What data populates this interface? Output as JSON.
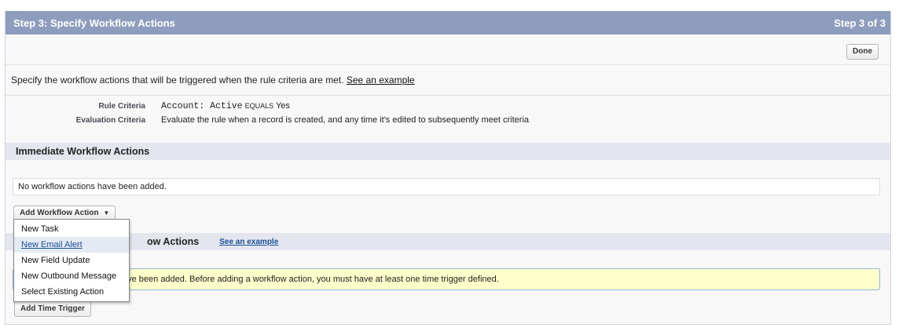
{
  "header": {
    "title": "Step 3: Specify Workflow Actions",
    "step": "Step 3 of 3"
  },
  "toolbar": {
    "done_label": "Done"
  },
  "intro": {
    "text": "Specify the workflow actions that will be triggered when the rule criteria are met.",
    "link": "See an example"
  },
  "criteria": {
    "rule_label": "Rule Criteria",
    "rule_field": "Account: Active",
    "rule_operator": "EQUALS",
    "rule_value": "Yes",
    "evaluation_label": "Evaluation Criteria",
    "evaluation_value": "Evaluate the rule when a record is created, and any time it's edited to subsequently meet criteria"
  },
  "immediate": {
    "title": "Immediate Workflow Actions",
    "empty_text": "No workflow actions have been added.",
    "add_label": "Add Workflow Action",
    "caret": "▼"
  },
  "time_triggered": {
    "title_partial": "ow Actions",
    "link": "See an example",
    "empty_partial": "ave been added. Before adding a workflow action, you must have at least one time trigger defined.",
    "add_trigger_label": "Add Time Trigger"
  },
  "dropdown": {
    "items": [
      "New Task",
      "New Email Alert",
      "New Field Update",
      "New Outbound Message",
      "Select Existing Action"
    ],
    "highlighted_index": 1
  }
}
